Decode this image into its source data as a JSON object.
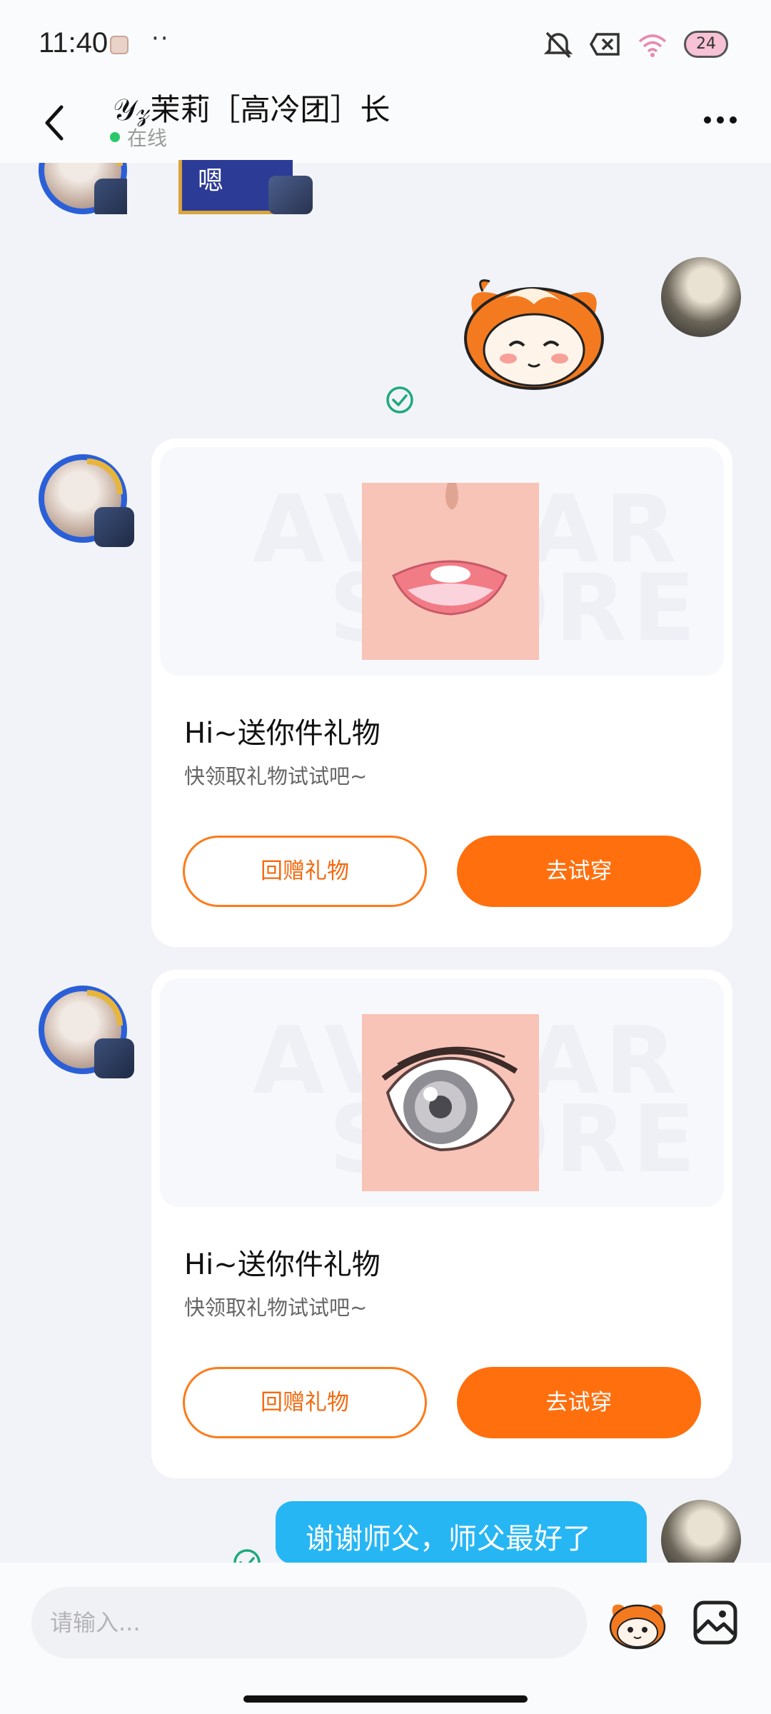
{
  "status_bar": {
    "time": "11:40",
    "dots": "··",
    "battery": "24"
  },
  "header": {
    "title": "𝒴𝓏茉莉［高冷团］长",
    "status": "在线"
  },
  "messages": {
    "partial_card_text": "嗯",
    "gift_cards": [
      {
        "title": "Hi~送你件礼物",
        "subtitle": "快领取礼物试试吧~",
        "return_label": "回赠礼物",
        "try_label": "去试穿",
        "thumb": "mouth-item-icon"
      },
      {
        "title": "Hi~送你件礼物",
        "subtitle": "快领取礼物试试吧~",
        "return_label": "回赠礼物",
        "try_label": "去试穿",
        "thumb": "eye-item-icon"
      }
    ],
    "outgoing_text": "谢谢师父，师父最好了"
  },
  "input": {
    "placeholder": "请输入..."
  },
  "colors": {
    "accent_orange": "#ff6f0e",
    "bubble_blue": "#26b6f4",
    "online_green": "#2bc86a"
  }
}
